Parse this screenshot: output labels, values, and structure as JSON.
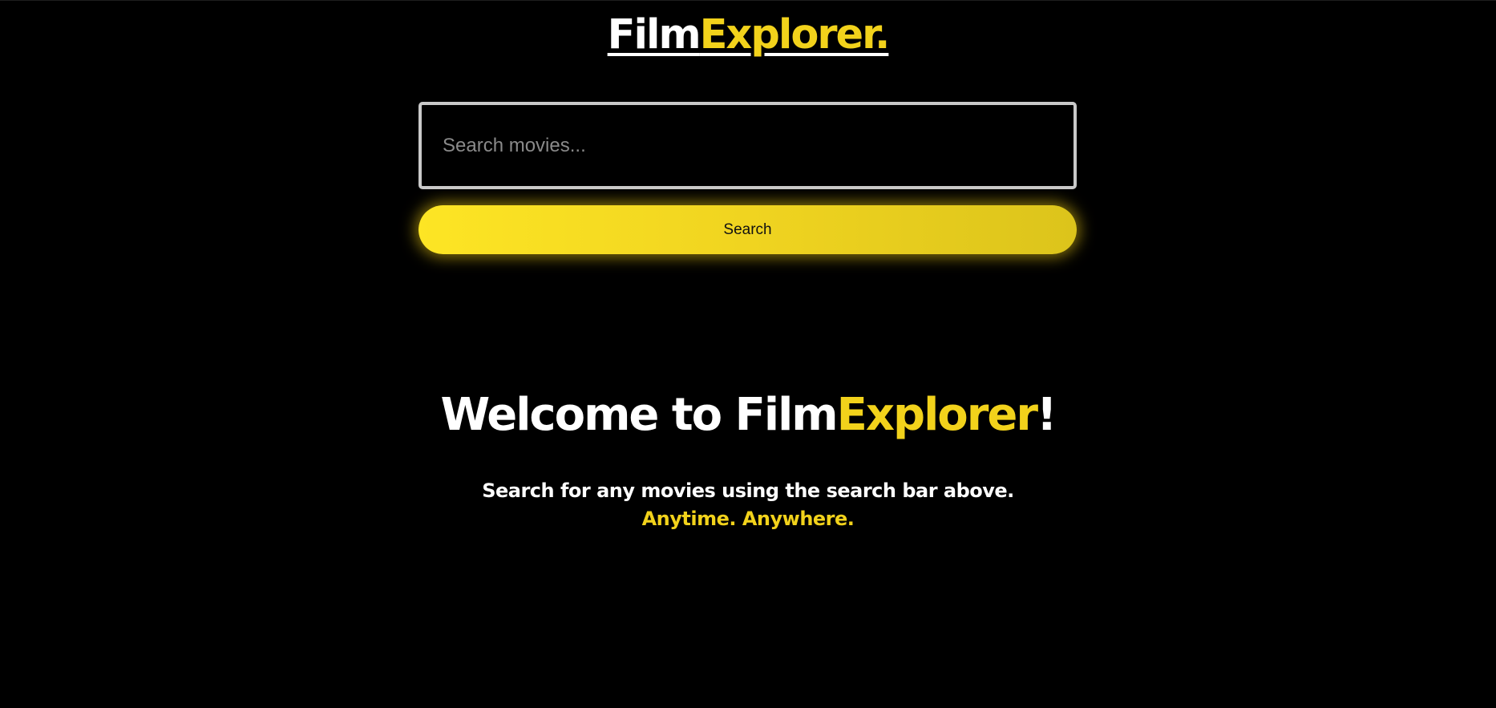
{
  "header": {
    "logo_part1": "Film",
    "logo_part2": "Explorer."
  },
  "search": {
    "placeholder": "Search movies...",
    "value": "",
    "button_label": "Search"
  },
  "welcome": {
    "title_part1": "Welcome to Film",
    "title_part2": "Explorer",
    "title_part3": "!",
    "line1": "Search for any movies using the search bar above.",
    "line2": "Anytime. Anywhere."
  },
  "colors": {
    "background": "#000000",
    "accent": "#f2d21b",
    "text": "#ffffff",
    "input_border": "#c9c9c9"
  }
}
